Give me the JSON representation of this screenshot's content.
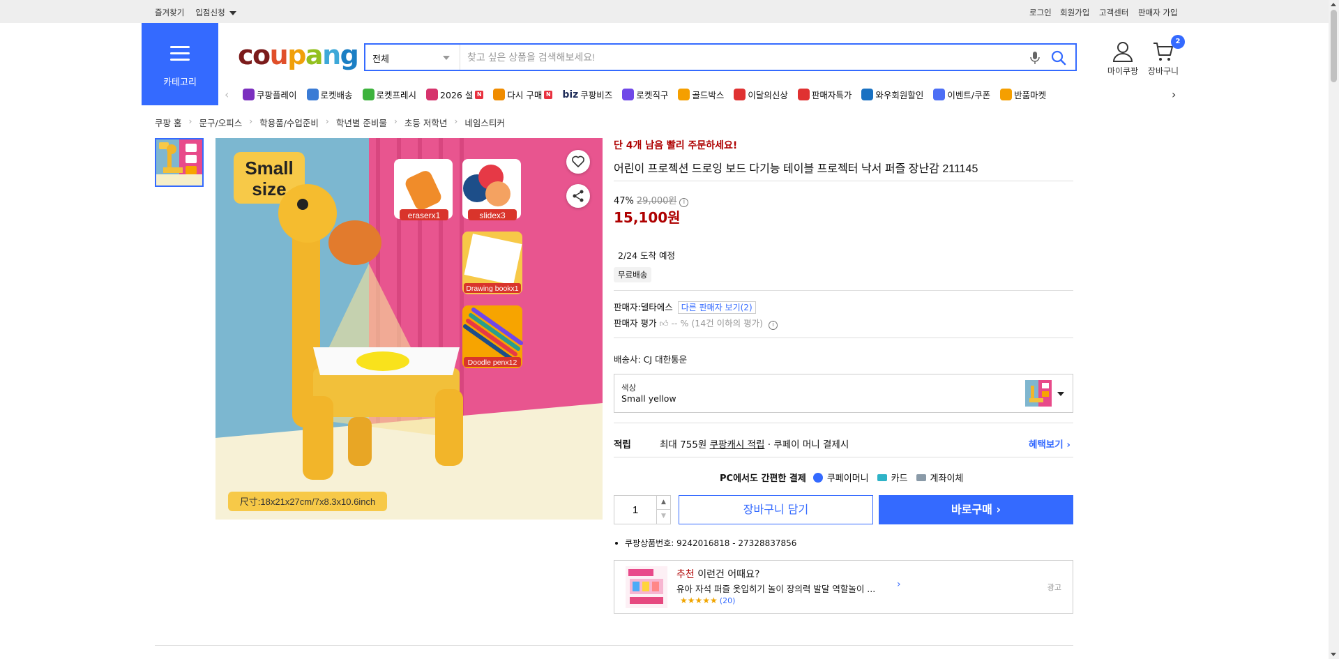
{
  "topbar": {
    "left": [
      "즐겨찾기",
      "입점신청"
    ],
    "right": [
      "로그인",
      "회원가입",
      "고객센터",
      "판매자 가입"
    ]
  },
  "header": {
    "category_label": "카테고리",
    "logo": "coupang",
    "search": {
      "category": "전체",
      "placeholder": "찾고 싶은 상품을 검색해보세요!"
    },
    "my_coupang": "마이쿠팡",
    "cart": {
      "label": "장바구니",
      "count": "2"
    }
  },
  "quicknav": [
    {
      "label": "쿠팡플레이",
      "icon": "play-icon",
      "color": "#7b2fbf"
    },
    {
      "label": "로켓배송",
      "icon": "rocket-icon",
      "color": "#3a7bd5"
    },
    {
      "label": "로켓프레시",
      "icon": "rocket-fresh-icon",
      "color": "#3db33d"
    },
    {
      "label": "2026 설",
      "icon": "gift-icon",
      "color": "#d6336c",
      "new": "N"
    },
    {
      "label": "다시 구매",
      "icon": "home-icon",
      "color": "#f08c00",
      "new": "N"
    },
    {
      "label": "쿠팡비즈",
      "icon": "biz-icon",
      "color": "#1f2d5a",
      "prefix": "biz"
    },
    {
      "label": "로켓직구",
      "icon": "globe-icon",
      "color": "#7048e8"
    },
    {
      "label": "골드박스",
      "icon": "goldbox-icon",
      "color": "#f59f00"
    },
    {
      "label": "이달의신상",
      "icon": "bag-icon",
      "color": "#e03131"
    },
    {
      "label": "판매자특가",
      "icon": "percent-icon",
      "color": "#e03131"
    },
    {
      "label": "와우회원할인",
      "icon": "wow-icon",
      "color": "#1971c2"
    },
    {
      "label": "이벤트/쿠폰",
      "icon": "coupon-icon",
      "color": "#4c6ef5"
    },
    {
      "label": "반품마켓",
      "icon": "market-icon",
      "color": "#f59f00"
    }
  ],
  "breadcrumb": [
    "쿠팡 홈",
    "문구/오피스",
    "학용품/수업준비",
    "학년별 준비물",
    "초등 저학년",
    "네임스티커"
  ],
  "gallery": {
    "badge": "Small\nsize",
    "labels": [
      "eraserx1",
      "slidex3",
      "Drawing bookx1",
      "Doodle penx12"
    ],
    "size_text": "尺寸:18x21x27cm/7x8.3x10.6inch"
  },
  "product": {
    "stock_alert": "단 4개 남음 빨리 주문하세요!",
    "title": "어린이 프로젝션 드로잉 보드 다기능 테이블 프로젝터 낙서 퍼즐 장난감 211145",
    "discount": "47%",
    "original_price": "29,000원",
    "price": "15,100원",
    "arrival": "2/24 도착 예정",
    "free_shipping": "무료배송",
    "seller_label": "판매자:",
    "seller_name": "델타에스",
    "other_sellers": "다른 판매자 보기(2)",
    "seller_rating_label": "판매자 평가",
    "seller_rating_value": "-- % (14건 이하의 평가)",
    "carrier": "배송사:  CJ 대한통운",
    "option": {
      "label": "색상",
      "value": "Small yellow"
    },
    "cash": {
      "label": "적립",
      "prefix": "최대 755원 ",
      "link": "쿠팡캐시 적립",
      "suffix": " · 쿠페이 머니 결제시",
      "benefit": "혜택보기"
    },
    "pay": {
      "label": "PC에서도 간편한 결제",
      "methods": [
        "쿠페이머니",
        "카드",
        "계좌이체"
      ]
    },
    "quantity": "1",
    "add_to_cart": "장바구니 담기",
    "buy_now": "바로구매",
    "product_number": "쿠팡상품번호: 9242016818 - 27328837856"
  },
  "recommend": {
    "head_red": "추천",
    "head_rest": " 이런건 어때요?",
    "desc": "유아 자석 퍼즐 옷입히기 놀이 장의력 발달 역할놀이 ...",
    "stars": "★★★★★",
    "count": "(20)",
    "ad": "광고"
  },
  "colors": {
    "accent": "#346aff",
    "price_red": "#ae0000"
  }
}
